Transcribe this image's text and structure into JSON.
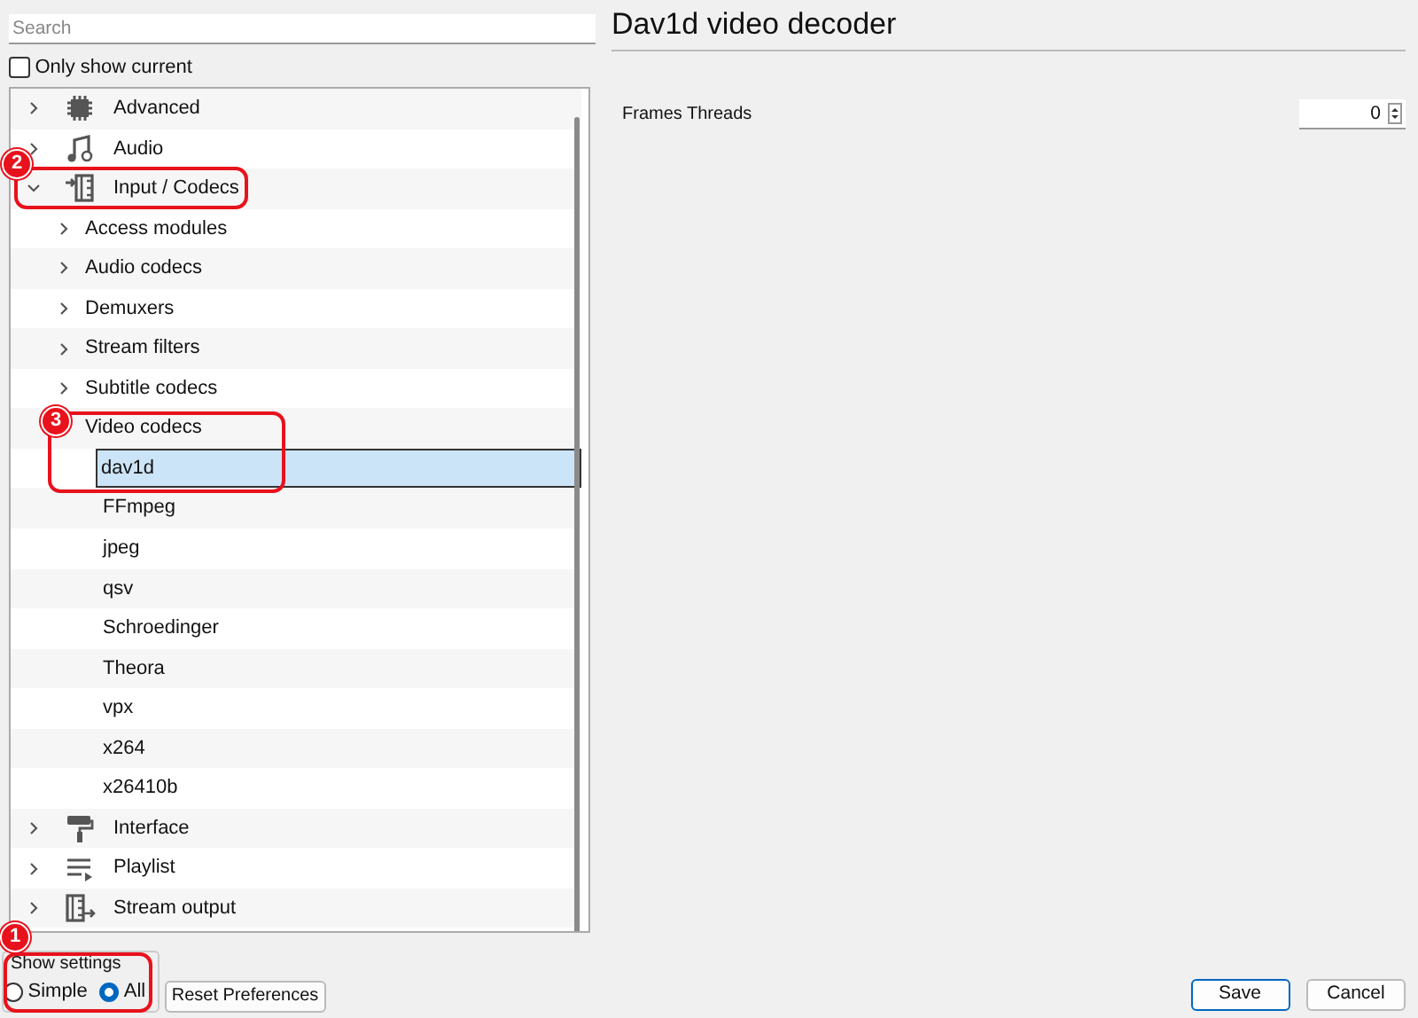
{
  "search": {
    "placeholder": "Search"
  },
  "only_show_current": {
    "label": "Only show current",
    "checked": false
  },
  "tree": [
    {
      "label": "Advanced",
      "kind": "chip",
      "expanded": false,
      "selected": false
    },
    {
      "label": "Audio",
      "kind": "music",
      "expanded": false,
      "selected": false
    },
    {
      "label": "Input / Codecs",
      "kind": "codec",
      "expanded": true,
      "selected": false,
      "children": [
        {
          "label": "Access modules",
          "expanded": false,
          "selected": false
        },
        {
          "label": "Audio codecs",
          "expanded": false,
          "selected": false
        },
        {
          "label": "Demuxers",
          "expanded": false,
          "selected": false
        },
        {
          "label": "Stream filters",
          "expanded": false,
          "selected": false
        },
        {
          "label": "Subtitle codecs",
          "expanded": false,
          "selected": false
        },
        {
          "label": "Video codecs",
          "selected": false,
          "children": [
            {
              "label": "dav1d",
              "selected": true
            },
            {
              "label": "FFmpeg",
              "selected": false
            },
            {
              "label": "jpeg",
              "selected": false
            },
            {
              "label": "qsv",
              "selected": false
            },
            {
              "label": "Schroedinger",
              "selected": false
            },
            {
              "label": "Theora",
              "selected": false
            },
            {
              "label": "vpx",
              "selected": false
            },
            {
              "label": "x264",
              "selected": false
            },
            {
              "label": "x26410b",
              "selected": false
            }
          ]
        }
      ]
    },
    {
      "label": "Interface",
      "kind": "roller",
      "expanded": false,
      "selected": false
    },
    {
      "label": "Playlist",
      "kind": "playlist",
      "expanded": false,
      "selected": false
    },
    {
      "label": "Stream output",
      "kind": "stream",
      "expanded": false,
      "selected": false
    }
  ],
  "show_settings": {
    "title": "Show settings",
    "options": [
      {
        "label": "Simple",
        "selected": false
      },
      {
        "label": "All",
        "selected": true
      }
    ]
  },
  "reset_button": "Reset Preferences",
  "panel": {
    "title": "Dav1d video decoder",
    "settings": [
      {
        "label": "Frames Threads",
        "value": "0"
      }
    ]
  },
  "buttons": [
    {
      "label": "Save",
      "default": true
    },
    {
      "label": "Cancel",
      "default": false
    }
  ],
  "annotations": [
    "1",
    "2",
    "3"
  ]
}
